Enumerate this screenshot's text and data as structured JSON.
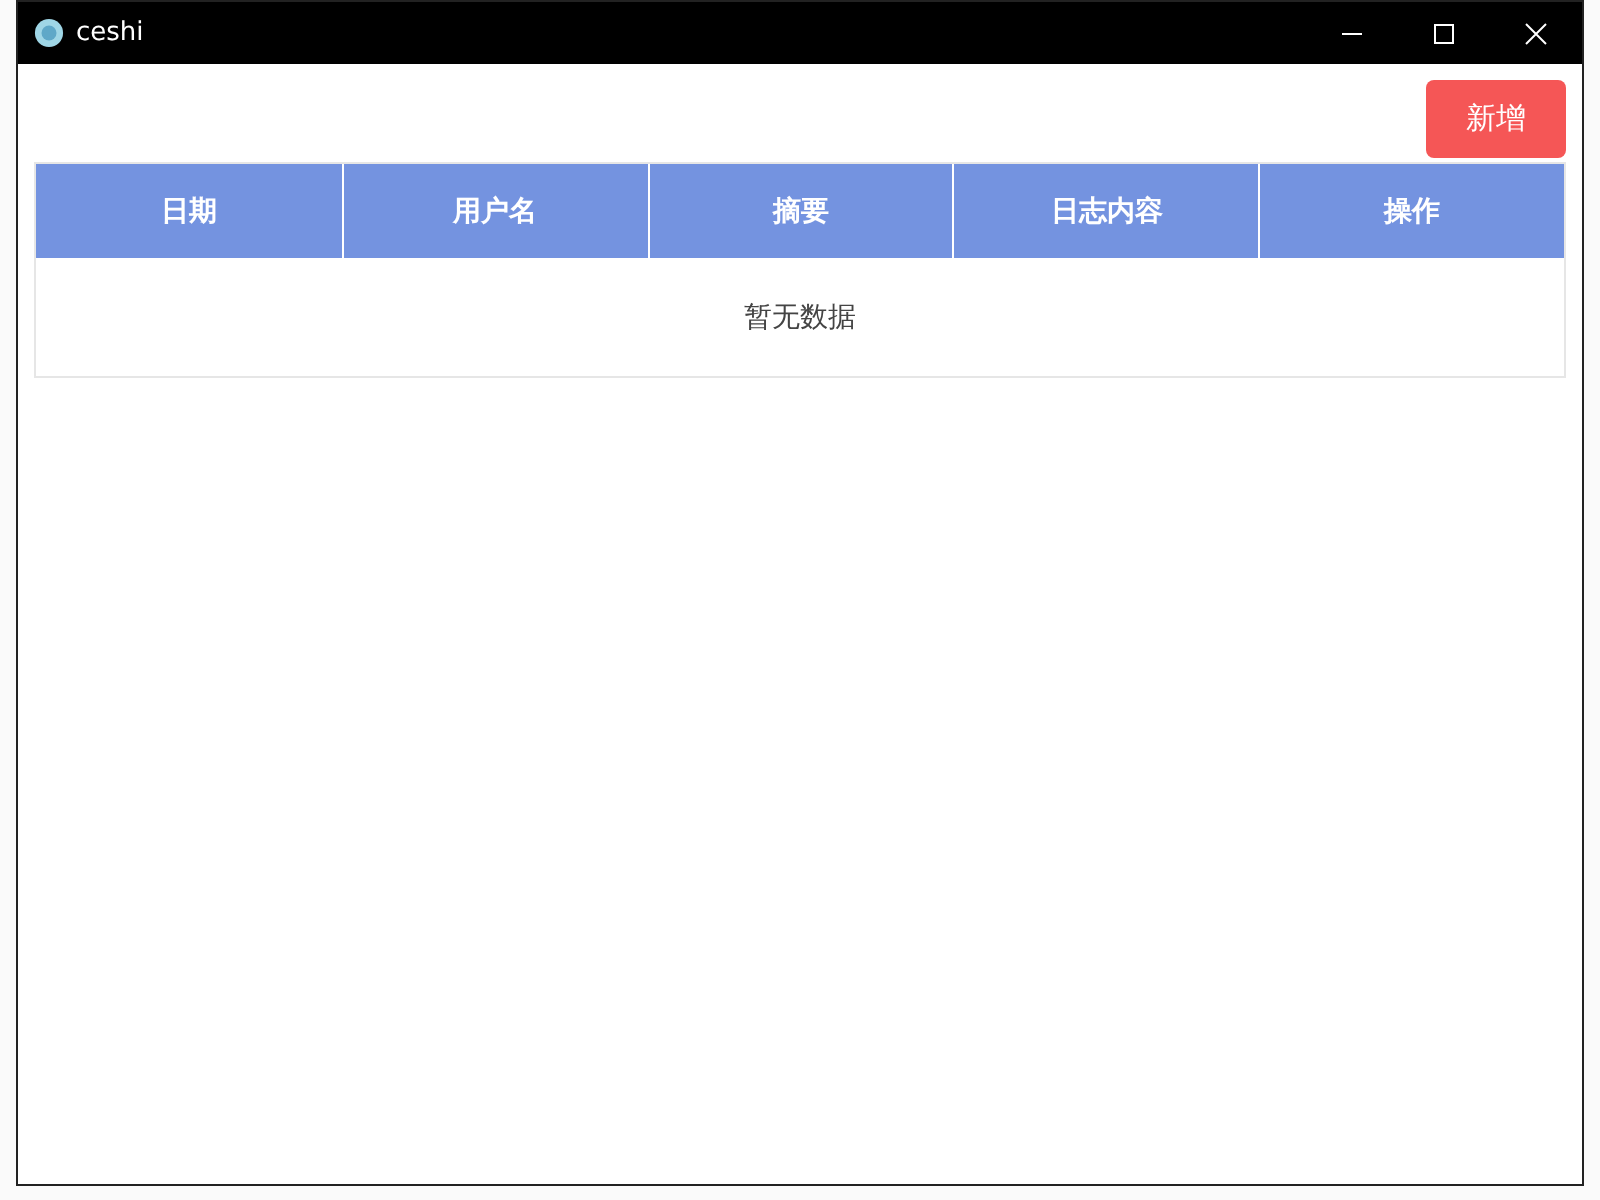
{
  "window": {
    "title": "ceshi"
  },
  "toolbar": {
    "add_button": "新增"
  },
  "table": {
    "columns": [
      "日期",
      "用户名",
      "摘要",
      "日志内容",
      "操作"
    ],
    "empty_text": "暂无数据"
  }
}
